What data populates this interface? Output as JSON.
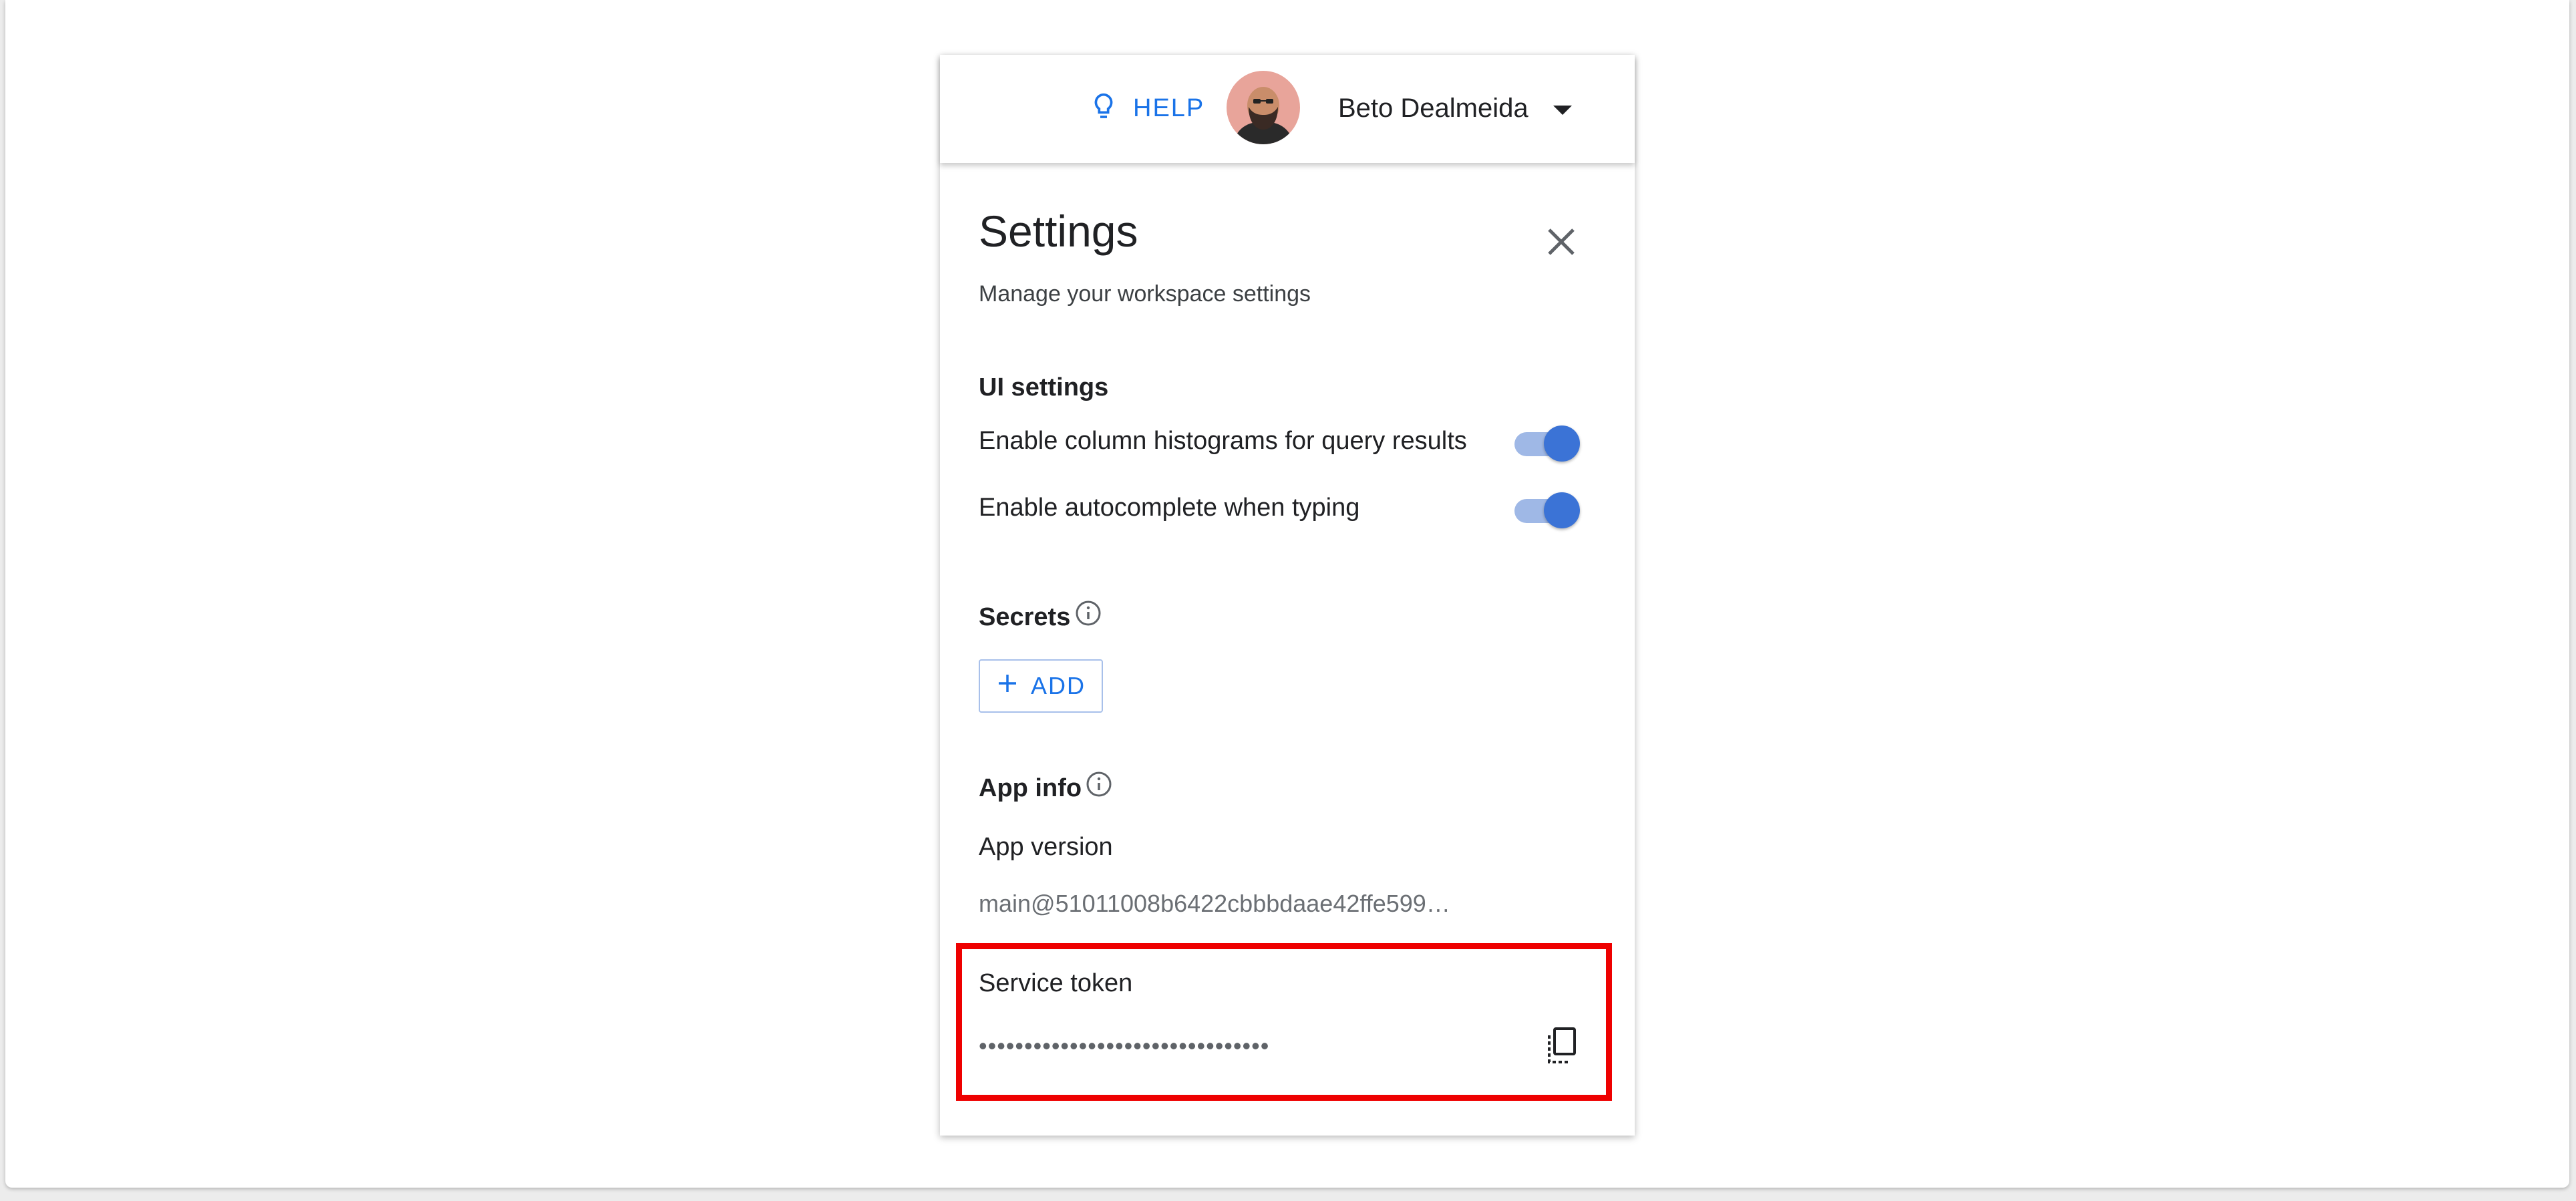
{
  "header": {
    "help_label": "HELP",
    "user_name": "Beto Dealmeida",
    "icons": {
      "help": "lightbulb-icon",
      "caret": "caret-down-icon"
    }
  },
  "settings": {
    "title": "Settings",
    "subtitle": "Manage your workspace settings",
    "ui_settings": {
      "heading": "UI settings",
      "items": [
        {
          "label": "Enable column histograms for query results",
          "enabled": true
        },
        {
          "label": "Enable autocomplete when typing",
          "enabled": true
        }
      ]
    },
    "secrets": {
      "heading": "Secrets",
      "add_label": "ADD"
    },
    "app_info": {
      "heading": "App info",
      "version_label": "App version",
      "version_value": "main@51011008b6422cbbbdaae42ffe599…",
      "token_label": "Service token",
      "token_value": "••••••••••••••••••••••••••••••••"
    }
  },
  "colors": {
    "accent": "#1a73e8",
    "toggle_on": "#3b73d6",
    "highlight": "#ee0000"
  }
}
